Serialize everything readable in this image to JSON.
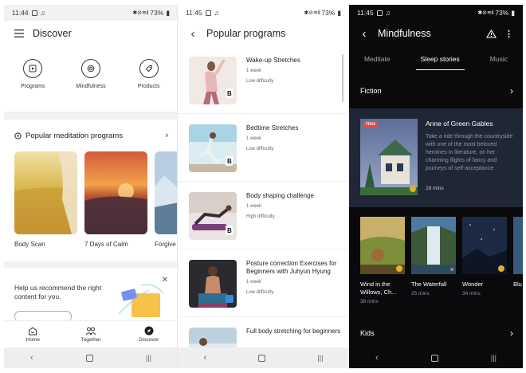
{
  "panel1": {
    "status": {
      "time": "11:44",
      "battery": "73%"
    },
    "title": "Discover",
    "categories": [
      {
        "label": "Programs",
        "icon": "play-icon"
      },
      {
        "label": "Mindfulness",
        "icon": "mindfulness-icon"
      },
      {
        "label": "Products",
        "icon": "tag-icon"
      }
    ],
    "section_title": "Popular meditation programs",
    "cards": [
      {
        "label": "Body Scan"
      },
      {
        "label": "7 Days of Calm"
      },
      {
        "label": "Forgive"
      }
    ],
    "recommend_text": "Help us recommend the right content for you.",
    "nav": [
      {
        "label": "Home",
        "icon": "home-icon"
      },
      {
        "label": "Together",
        "icon": "together-icon"
      },
      {
        "label": "Discover",
        "icon": "discover-icon"
      }
    ]
  },
  "panel2": {
    "status": {
      "time": "11:45",
      "battery": "73%"
    },
    "title": "Popular programs",
    "programs": [
      {
        "title": "Wake-up Stretches",
        "duration": "1 week",
        "difficulty": "Low difficulty"
      },
      {
        "title": "Bedtime Stretches",
        "duration": "1 week",
        "difficulty": "Low difficulty"
      },
      {
        "title": "Body shaping challenge",
        "duration": "1 week",
        "difficulty": "High difficulty"
      },
      {
        "title": "Posture correction Exercises for Beginners with Juhyun Hyung",
        "duration": "1 week",
        "difficulty": "Low difficulty"
      },
      {
        "title": "Full body stretching for beginners",
        "duration": "",
        "difficulty": ""
      }
    ]
  },
  "panel3": {
    "status": {
      "time": "11:45",
      "battery": "73%"
    },
    "title": "Mindfulness",
    "tabs": [
      "Meditate",
      "Sleep stories",
      "Music"
    ],
    "section_fiction": "Fiction",
    "section_kids": "Kids",
    "featured": {
      "badge": "New",
      "title": "Anne of Green Gables",
      "description": "Take a ride through the countryside with one of the most beloved heroines in literature, on her charming flights of fancy and journeys of self-acceptance",
      "duration": "28 mins"
    },
    "stories": [
      {
        "title": "Wind in the",
        "title2": "Willows, Ch...",
        "duration": "38 mins"
      },
      {
        "title": "The Waterfall",
        "title2": "",
        "duration": "25 mins"
      },
      {
        "title": "Wonder",
        "title2": "",
        "duration": "34 mins"
      },
      {
        "title": "Blu",
        "title2": "",
        "duration": ""
      }
    ]
  }
}
